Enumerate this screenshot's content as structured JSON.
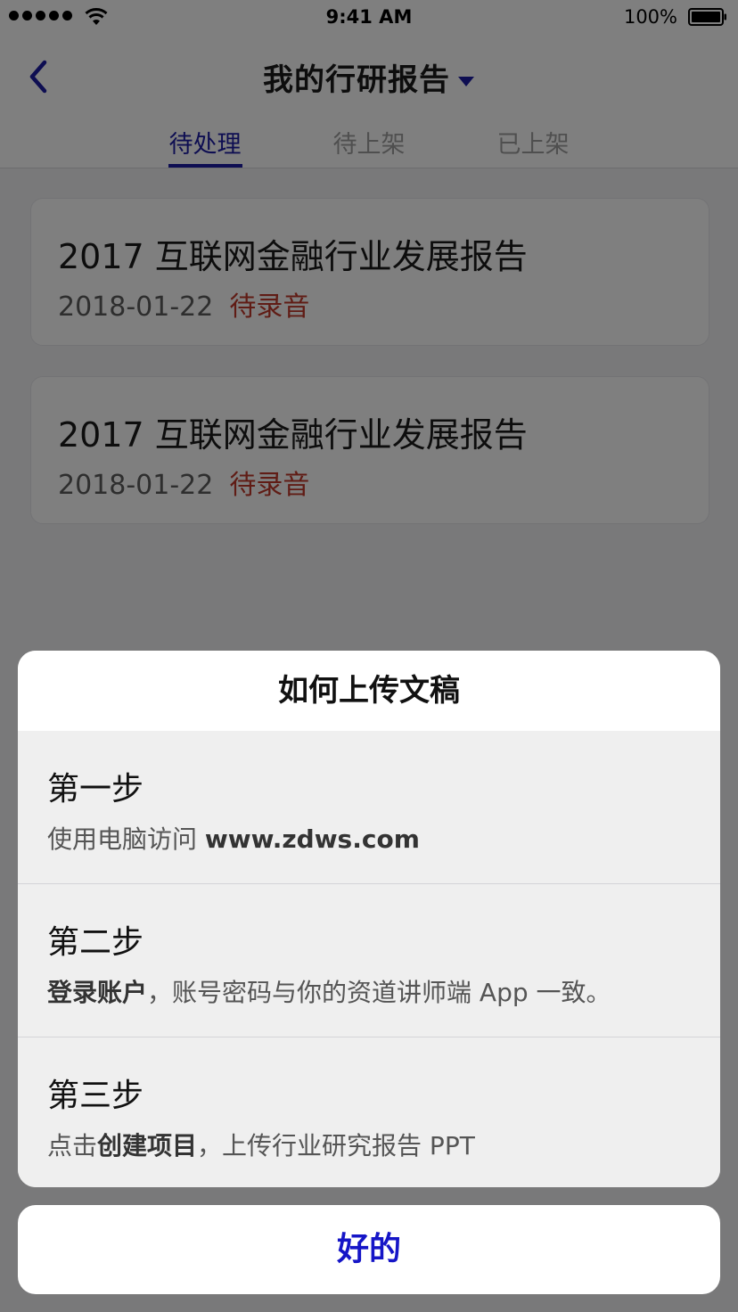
{
  "status_bar": {
    "time": "9:41 AM",
    "battery_percent": "100%",
    "signal_bars": 5
  },
  "nav": {
    "title": "我的行研报告",
    "tabs": [
      {
        "label": "待处理",
        "active": true
      },
      {
        "label": "待上架",
        "active": false
      },
      {
        "label": "已上架",
        "active": false
      }
    ]
  },
  "reports": [
    {
      "title": "2017 互联网金融行业发展报告",
      "date": "2018-01-22",
      "status": "待录音"
    },
    {
      "title": "2017 互联网金融行业发展报告",
      "date": "2018-01-22",
      "status": "待录音"
    }
  ],
  "dialog": {
    "title": "如何上传文稿",
    "steps": [
      {
        "heading": "第一步",
        "desc_prefix": "使用电脑访问 ",
        "desc_bold": "www.zdws.com",
        "desc_suffix": ""
      },
      {
        "heading": "第二步",
        "desc_prefix": "",
        "desc_bold": "登录账户",
        "desc_suffix": "，账号密码与你的资道讲师端 App 一致。"
      },
      {
        "heading": "第三步",
        "desc_prefix": "点击",
        "desc_bold": "创建项目",
        "desc_suffix": "，上传行业研究报告 PPT"
      }
    ],
    "confirm_label": "好的"
  },
  "colors": {
    "accent": "#1c1ca5",
    "status_red": "#c0392b",
    "confirm_blue": "#1515c7"
  },
  "icons": {
    "back": "chevron-left-icon",
    "dropdown": "triangle-down-icon",
    "wifi": "wifi-icon",
    "battery": "battery-icon"
  }
}
